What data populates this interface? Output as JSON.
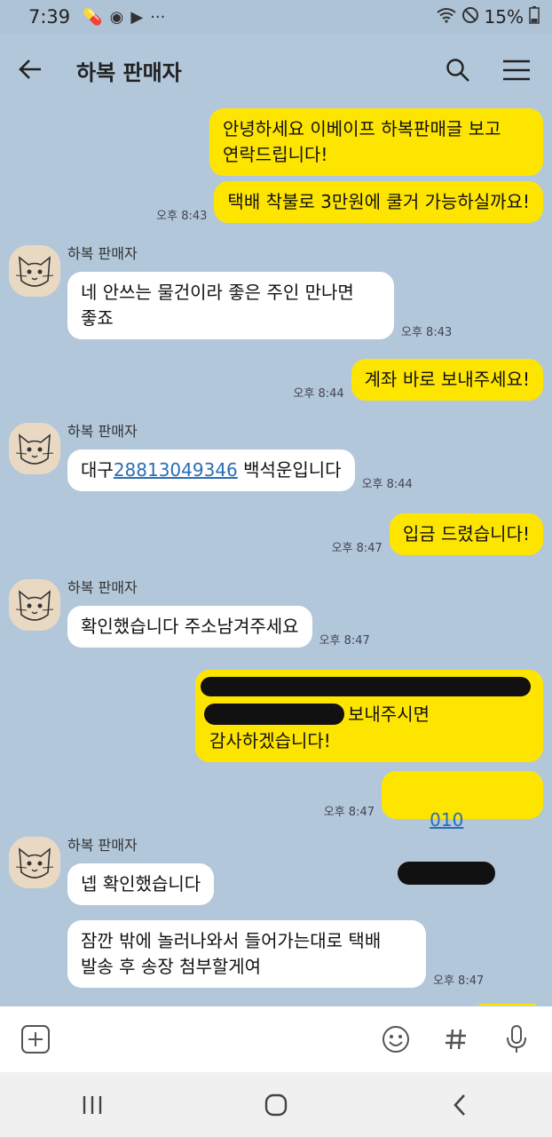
{
  "status": {
    "time": "7:39",
    "battery": "15%"
  },
  "header": {
    "title": "하복 판매자"
  },
  "messages": {
    "m1": "안녕하세요 이베이프 하복판매글 보고\n연락드립니다!",
    "m2": "택배 착불로 3만원에 쿨거 가능하실까요!",
    "t2": "오후 8:43",
    "sender": "하복 판매자",
    "m3": "네 안쓰는 물건이라 좋은 주인 만나면\n좋죠",
    "t3": "오후 8:43",
    "m4": "계좌 바로 보내주세요!",
    "t4": "오후 8:44",
    "m5_prefix": "대구",
    "m5_link": "28813049346",
    "m5_suffix": " 백석운입니다",
    "t5": "오후 8:44",
    "m6": "입금 드렸습니다!",
    "t6": "오후 8:47",
    "m7": "확인했습니다 주소남겨주세요",
    "t7": "오후 8:47",
    "m8_visible": "보내주시면",
    "m8_line3": "감사하겠습니다!",
    "m9_prefix": "010",
    "t9": "오후 8:47",
    "m10": "넵 확인했습니다",
    "m11": "잠깐 밖에 놀러나와서 들어가는대로 택배\n발송 후 송장 첨부할게여",
    "t11": "오후 8:47"
  },
  "icons": [
    "back-arrow-icon",
    "search-icon",
    "menu-icon",
    "plus-icon",
    "emoji-icon",
    "hash-icon",
    "mic-icon",
    "recent-apps-icon",
    "home-icon",
    "nav-back-icon"
  ]
}
